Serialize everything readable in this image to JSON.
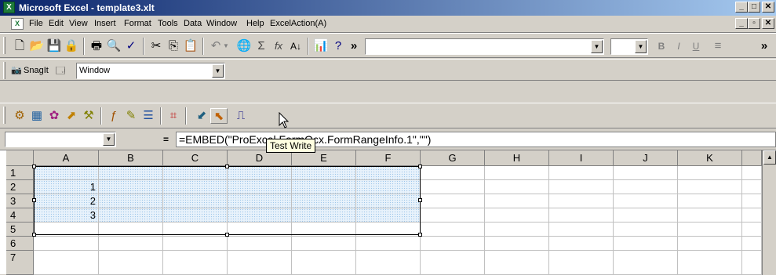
{
  "window": {
    "title": "Microsoft Excel - template3.xlt",
    "app_icon": "X",
    "minimize": "_",
    "maximize": "□",
    "close": "✕"
  },
  "menu": {
    "items": [
      {
        "label": "File"
      },
      {
        "label": "Edit"
      },
      {
        "label": "View"
      },
      {
        "label": "Insert"
      },
      {
        "label": "Format"
      },
      {
        "label": "Tools"
      },
      {
        "label": "Data"
      },
      {
        "label": "Window"
      },
      {
        "label": "Help"
      },
      {
        "label": "ExcelAction(A)"
      }
    ],
    "doc_minimize": "_",
    "doc_restore": "▫",
    "doc_close": "✕"
  },
  "toolbar_standard": {
    "font_name": "",
    "font_size": "",
    "bold": "B",
    "italic": "I",
    "underline": "U",
    "more": "»"
  },
  "toolbar_snagit": {
    "snagit_label": "SnagIt",
    "capture_mode": "Window"
  },
  "formula_bar": {
    "name_box": "",
    "equals": "=",
    "formula": "=EMBED(\"ProExcel.FormOcx.FormRangeInfo.1\",\"\")"
  },
  "tooltip": "Test Write",
  "sheet": {
    "columns": [
      "A",
      "B",
      "C",
      "D",
      "E",
      "F",
      "G",
      "H",
      "I",
      "J",
      "K"
    ],
    "rows": [
      "1",
      "2",
      "3",
      "4",
      "5",
      "6",
      "7"
    ],
    "column_a_values": [
      "",
      "1",
      "2",
      "3",
      "",
      "",
      ""
    ]
  },
  "colors": {
    "title_start": "#0a246a",
    "title_end": "#a6caf0",
    "selection_fill": "#e8f2fb"
  }
}
